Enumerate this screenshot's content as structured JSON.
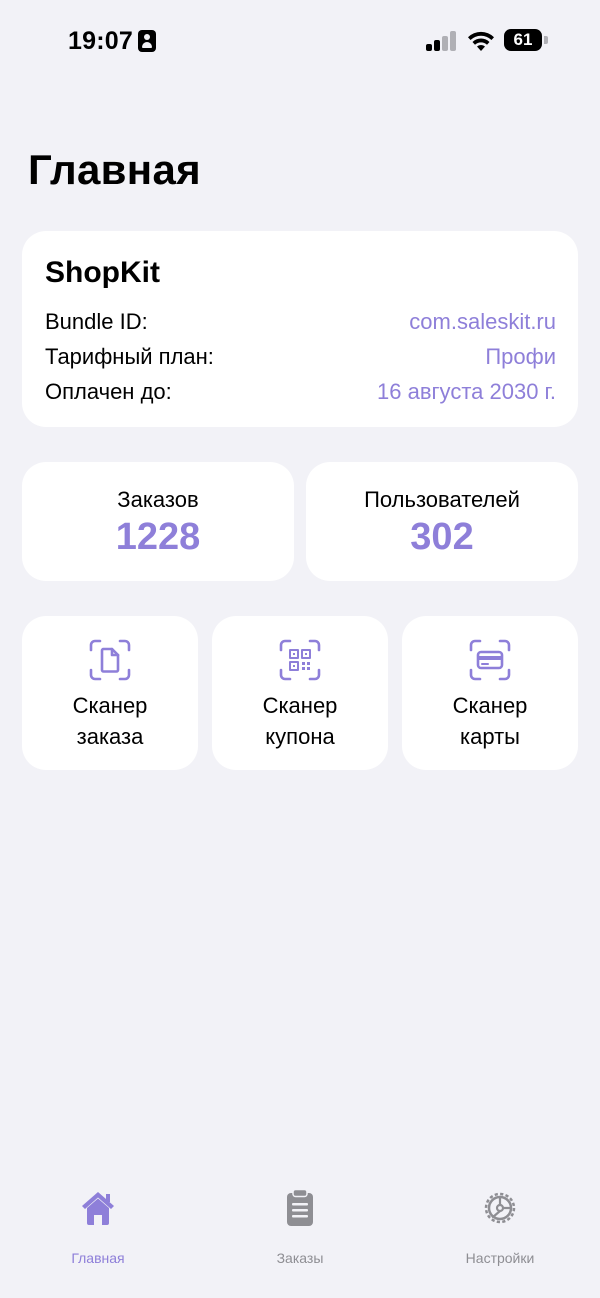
{
  "status_bar": {
    "time": "19:07",
    "battery_level": "61"
  },
  "page_title": "Главная",
  "app_card": {
    "name": "ShopKit",
    "rows": [
      {
        "label": "Bundle ID:",
        "value": "com.saleskit.ru"
      },
      {
        "label": "Тарифный план:",
        "value": "Профи"
      },
      {
        "label": "Оплачен до:",
        "value": "16 августа 2030 г."
      }
    ]
  },
  "stats": {
    "orders": {
      "label": "Заказов",
      "value": "1228"
    },
    "users": {
      "label": "Пользователей",
      "value": "302"
    }
  },
  "actions": [
    {
      "line1": "Сканер",
      "line2": "заказа",
      "icon": "document-scan-icon"
    },
    {
      "line1": "Сканер",
      "line2": "купона",
      "icon": "qr-scan-icon"
    },
    {
      "line1": "Сканер",
      "line2": "карты",
      "icon": "card-scan-icon"
    }
  ],
  "tabs": [
    {
      "label": "Главная",
      "icon": "house-icon",
      "active": true
    },
    {
      "label": "Заказы",
      "icon": "clipboard-icon",
      "active": false
    },
    {
      "label": "Настройки",
      "icon": "gear-icon",
      "active": false
    }
  ],
  "colors": {
    "accent": "#8e7fd9",
    "background": "#f2f2f7",
    "card": "#ffffff",
    "inactive": "#8e8e93"
  }
}
